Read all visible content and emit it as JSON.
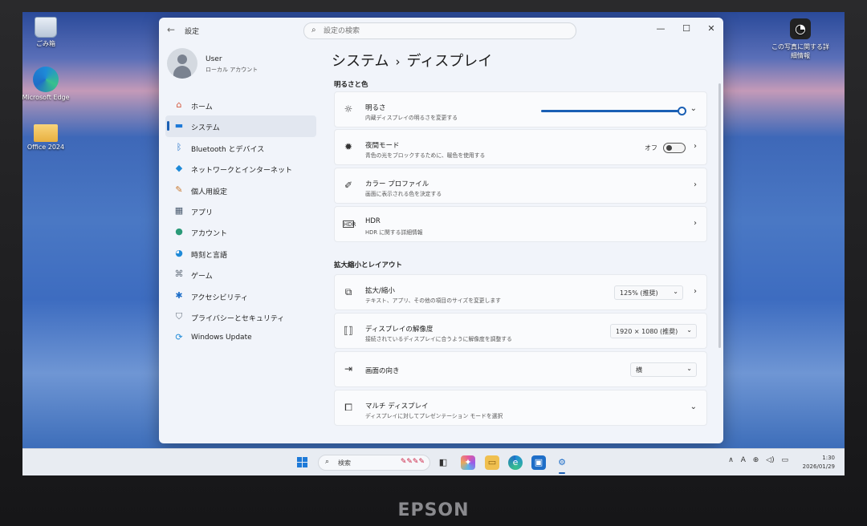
{
  "device": {
    "brand": "EPSON"
  },
  "desktop": {
    "icons": [
      {
        "label": "ごみ箱",
        "icon": "recycle-bin-icon"
      },
      {
        "label": "Microsoft Edge",
        "icon": "edge-icon"
      },
      {
        "label": "Office 2024",
        "icon": "folder-icon"
      }
    ],
    "photo_widget": {
      "label_line1": "この写真に関する詳",
      "label_line2": "細情報"
    }
  },
  "window": {
    "app_title": "設定",
    "search_placeholder": "設定の検索",
    "controls": {
      "minimize": "—",
      "maximize": "☐",
      "close": "✕"
    }
  },
  "profile": {
    "name": "User",
    "account_type": "ローカル アカウント"
  },
  "sidebar": {
    "items": [
      {
        "label": "ホーム",
        "icon": "home-icon",
        "active": false
      },
      {
        "label": "システム",
        "icon": "system-icon",
        "active": true
      },
      {
        "label": "Bluetooth とデバイス",
        "icon": "bluetooth-icon",
        "active": false
      },
      {
        "label": "ネットワークとインターネット",
        "icon": "network-icon",
        "active": false
      },
      {
        "label": "個人用設定",
        "icon": "brush-icon",
        "active": false
      },
      {
        "label": "アプリ",
        "icon": "apps-icon",
        "active": false
      },
      {
        "label": "アカウント",
        "icon": "account-icon",
        "active": false
      },
      {
        "label": "時刻と言語",
        "icon": "globe-icon",
        "active": false
      },
      {
        "label": "ゲーム",
        "icon": "gamepad-icon",
        "active": false
      },
      {
        "label": "アクセシビリティ",
        "icon": "accessibility-icon",
        "active": false
      },
      {
        "label": "プライバシーとセキュリティ",
        "icon": "shield-icon",
        "active": false
      },
      {
        "label": "Windows Update",
        "icon": "update-icon",
        "active": false
      }
    ]
  },
  "main": {
    "breadcrumb": {
      "parent": "システム",
      "separator": "›",
      "current": "ディスプレイ"
    },
    "sections": {
      "brightness_color": "明るさと色",
      "scale_layout": "拡大縮小とレイアウト"
    },
    "brightness": {
      "title": "明るさ",
      "subtitle": "内蔵ディスプレイの明るさを変更する",
      "value_percent": 100
    },
    "night_light": {
      "title": "夜間モード",
      "subtitle": "青色の光をブロックするために、暖色を使用する",
      "toggle_label": "オフ",
      "on": false
    },
    "color_profile": {
      "title": "カラー プロファイル",
      "subtitle": "画面に表示される色を決定する"
    },
    "hdr": {
      "title": "HDR",
      "subtitle": "HDR に関する詳細情報"
    },
    "scale": {
      "title": "拡大/縮小",
      "subtitle": "テキスト、アプリ、その他の項目のサイズを変更します",
      "value": "125% (推奨)"
    },
    "resolution": {
      "title": "ディスプレイの解像度",
      "subtitle": "接続されているディスプレイに合うように解像度を調整する",
      "value": "1920 × 1080 (推奨)"
    },
    "orientation": {
      "title": "画面の向き",
      "value": "横"
    },
    "multi_display": {
      "title": "マルチ ディスプレイ",
      "subtitle": "ディスプレイに対してプレゼンテーション モードを選択"
    }
  },
  "taskbar": {
    "search_label": "検索",
    "time": "1:30",
    "date": "2026/01/29",
    "tray": {
      "chevron": "∧",
      "ime": "A"
    }
  },
  "colors": {
    "accent": "#1a5fb4",
    "window_bg": "#f1f4fa",
    "card_bg": "#fafbfd"
  }
}
